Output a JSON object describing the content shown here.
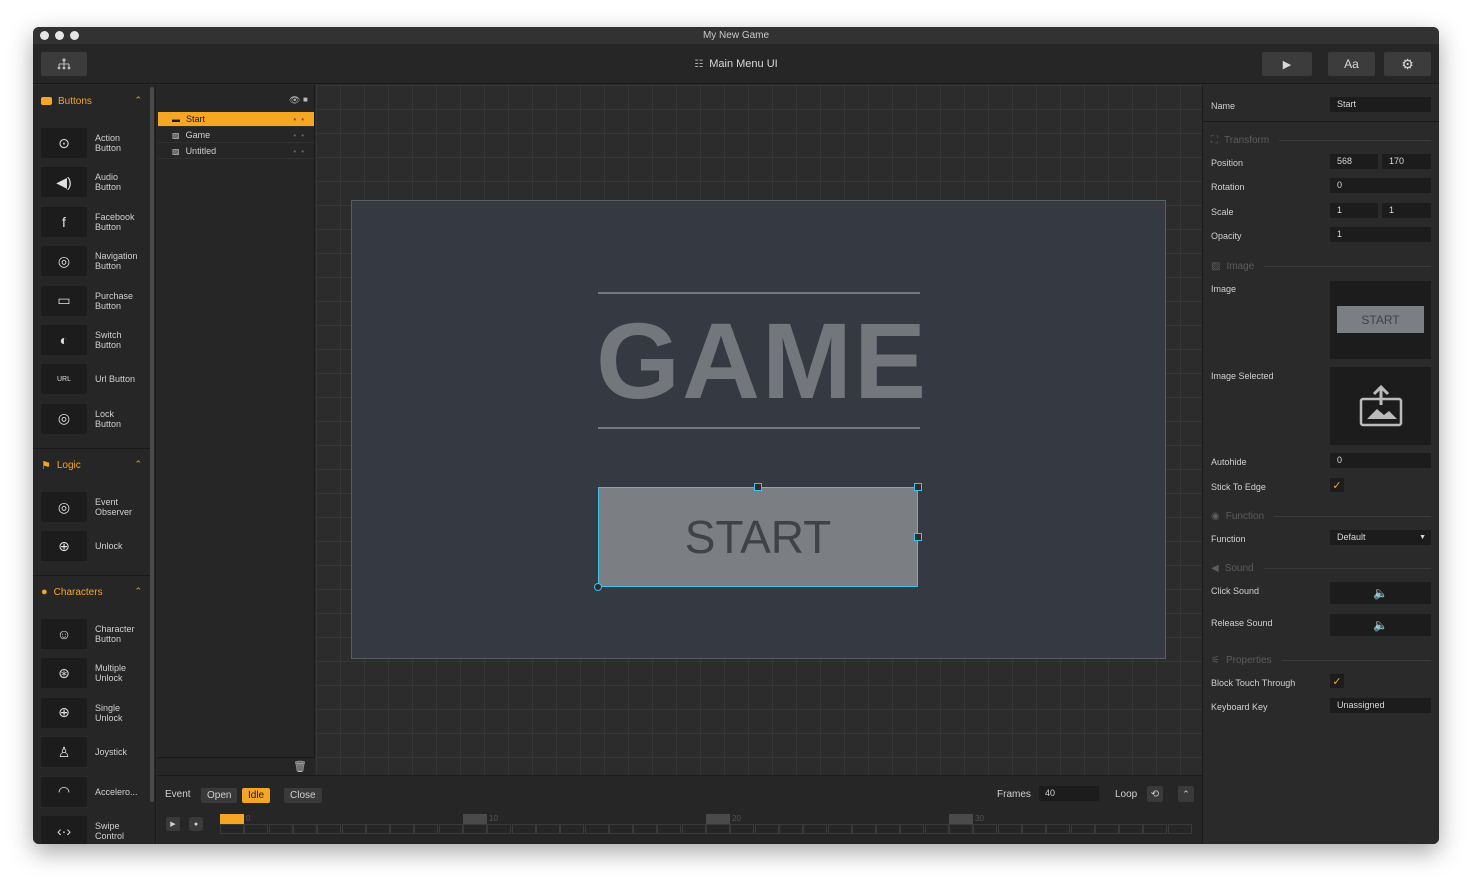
{
  "window": {
    "title": "My New Game"
  },
  "toolbar": {
    "scene_title": "Main Menu UI",
    "font_label": "Aa",
    "icons": {
      "scene_tree": "hierarchy-icon",
      "play": "play-icon",
      "settings": "gear-icon",
      "scene": "list-icon"
    }
  },
  "palette": {
    "buttons": {
      "label": "Buttons",
      "items": [
        {
          "label": "Action\nButton",
          "icon": "play-circle-icon"
        },
        {
          "label": "Audio\nButton",
          "icon": "speaker-icon"
        },
        {
          "label": "Facebook\nButton",
          "icon": "facebook-icon"
        },
        {
          "label": "Navigation\nButton",
          "icon": "navigation-icon"
        },
        {
          "label": "Purchase\nButton",
          "icon": "card-icon"
        },
        {
          "label": "Switch\nButton",
          "icon": "toggle-icon"
        },
        {
          "label": "Url Button",
          "icon": "url-icon"
        },
        {
          "label": "Lock\nButton",
          "icon": "lock-icon"
        }
      ]
    },
    "logic": {
      "label": "Logic",
      "items": [
        {
          "label": "Event\nObserver",
          "icon": "eye-target-icon"
        },
        {
          "label": "Unlock",
          "icon": "unlock-icon"
        }
      ]
    },
    "characters": {
      "label": "Characters",
      "items": [
        {
          "label": "Character\nButton",
          "icon": "character-icon"
        },
        {
          "label": "Multiple\nUnlock",
          "icon": "multiple-unlock-icon"
        },
        {
          "label": "Single\nUnlock",
          "icon": "single-unlock-icon"
        },
        {
          "label": "Joystick",
          "icon": "joystick-icon"
        },
        {
          "label": "Accelero...",
          "icon": "accelerometer-icon"
        },
        {
          "label": "Swipe\nControl",
          "icon": "swipe-icon"
        }
      ]
    }
  },
  "hierarchy": {
    "items": [
      {
        "label": "Start",
        "selected": true
      },
      {
        "label": "Game",
        "selected": false
      },
      {
        "label": "Untitled",
        "selected": false
      }
    ]
  },
  "stage": {
    "title_text": "GAME",
    "button_text": "START"
  },
  "timeline": {
    "event_label": "Event",
    "chips": [
      "Open",
      "Idle",
      "Close"
    ],
    "active_chip": "Idle",
    "frames_label": "Frames",
    "frames_value": "40",
    "loop_label": "Loop",
    "ticks": [
      "0",
      "10",
      "20",
      "30"
    ]
  },
  "inspector": {
    "name_label": "Name",
    "name_value": "Start",
    "transform": {
      "section": "Transform",
      "position_label": "Position",
      "position_x": "568",
      "position_y": "170",
      "rotation_label": "Rotation",
      "rotation": "0",
      "scale_label": "Scale",
      "scale_x": "1",
      "scale_y": "1",
      "opacity_label": "Opacity",
      "opacity": "1"
    },
    "image": {
      "section": "Image",
      "image_label": "Image",
      "image_preview_text": "START",
      "image_selected_label": "Image Selected",
      "autohide_label": "Autohide",
      "autohide": "0",
      "stick_label": "Stick To Edge",
      "stick": true
    },
    "function": {
      "section": "Function",
      "function_label": "Function",
      "function_value": "Default"
    },
    "sound": {
      "section": "Sound",
      "click_label": "Click Sound",
      "release_label": "Release Sound"
    },
    "properties": {
      "section": "Properties",
      "block_label": "Block Touch Through",
      "block": true,
      "keyboard_label": "Keyboard Key",
      "keyboard_value": "Unassigned"
    }
  },
  "colors": {
    "accent": "#f5a623",
    "selection": "#3fc1e8",
    "stage_bg": "#353942"
  }
}
